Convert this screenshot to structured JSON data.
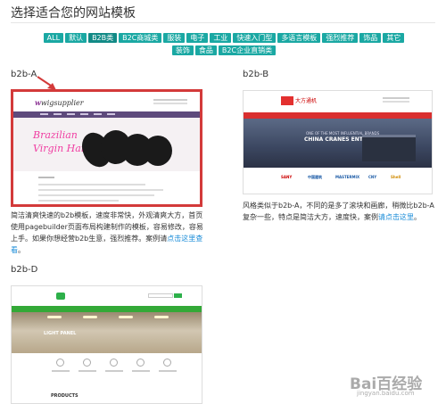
{
  "header": {
    "title": "选择适合您的网站模板"
  },
  "tags": [
    {
      "label": "ALL",
      "active": false
    },
    {
      "label": "默认",
      "active": false
    },
    {
      "label": "B2B类",
      "active": true
    },
    {
      "label": "B2C商城类",
      "active": false
    },
    {
      "label": "服装",
      "active": false
    },
    {
      "label": "电子",
      "active": false
    },
    {
      "label": "工业",
      "active": false
    },
    {
      "label": "快速入门型",
      "active": false
    },
    {
      "label": "多语言模板",
      "active": false
    },
    {
      "label": "强烈推荐",
      "active": false
    },
    {
      "label": "饰品",
      "active": false
    },
    {
      "label": "其它",
      "active": false
    },
    {
      "label": "装饰",
      "active": false
    },
    {
      "label": "食品",
      "active": false
    },
    {
      "label": "B2C企业直销类",
      "active": false
    }
  ],
  "templates": {
    "a": {
      "label": "b2b-A",
      "thumb_logo": "wigsupplier",
      "thumb_hero_line1": "Brazilian",
      "thumb_hero_line2": "Virgin Hair",
      "desc_text": "简洁清爽快速的b2b模板，速度非常快，外观清爽大方，首页使用pagebuilder页面布局构建制作的模板，容易修改，容易上手。如果你想经营b2b生意，强烈推荐。案例请",
      "desc_link": "点击这里查看",
      "desc_end": "。"
    },
    "b": {
      "label": "b2b-B",
      "thumb_logo": "大方通机",
      "thumb_hero_small": "ONE OF THE MOST INFLUENTIAL BRANDS",
      "thumb_hero": "CHINA CRANES ENTERPRISE 50",
      "brands": [
        "SANY",
        "中国建筑",
        "MASTERMIX",
        "CNY",
        "Shell"
      ],
      "desc_text": "风格类似于b2b-A，不同的是多了滚块和画廊，稍微比b2b-A复杂一些，特点是简洁大方，速度快，案例",
      "desc_link": "请点击这里",
      "desc_end": "。"
    },
    "d": {
      "label": "b2b-D",
      "thumb_hero": "LIGHT PANEL",
      "thumb_products": "PRODUCTS"
    }
  },
  "watermark": {
    "logo": "Bai百经验",
    "url": "jingyan.baidu.com"
  },
  "colors": {
    "tag": "#1aa8a3",
    "tag_active": "#128a86",
    "highlight_border": "#d33a3a",
    "link": "#1a8cd8"
  }
}
